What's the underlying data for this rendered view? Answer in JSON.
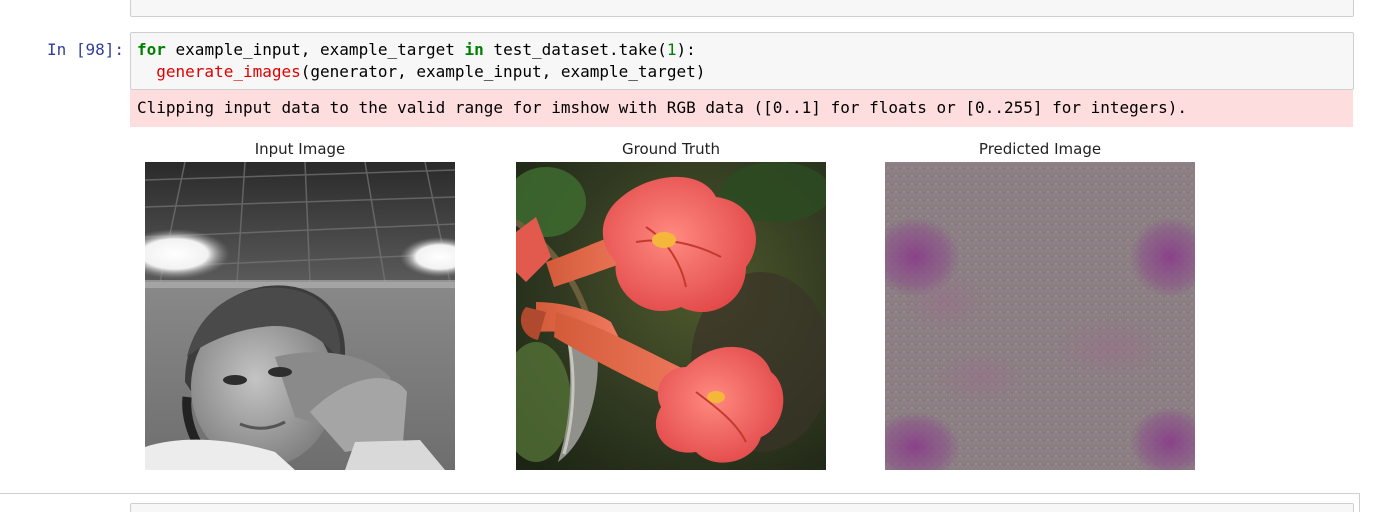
{
  "cell": {
    "prompt": "In [98]:",
    "code": {
      "l1_kw_for": "for",
      "l1_vars": " example_input, example_target ",
      "l1_kw_in": "in",
      "l1_rest_a": " test_dataset.take(",
      "l1_num": "1",
      "l1_rest_b": "):",
      "l2_indent": "  ",
      "l2_fn": "generate_images",
      "l2_args": "(generator, example_input, example_target)"
    },
    "stderr_text": "Clipping input data to the valid range for imshow with RGB data ([0..1] for floats or [0..255] for integers)."
  },
  "figure": {
    "panels": [
      {
        "title": "Input Image"
      },
      {
        "title": "Ground Truth"
      },
      {
        "title": "Predicted Image"
      }
    ]
  }
}
